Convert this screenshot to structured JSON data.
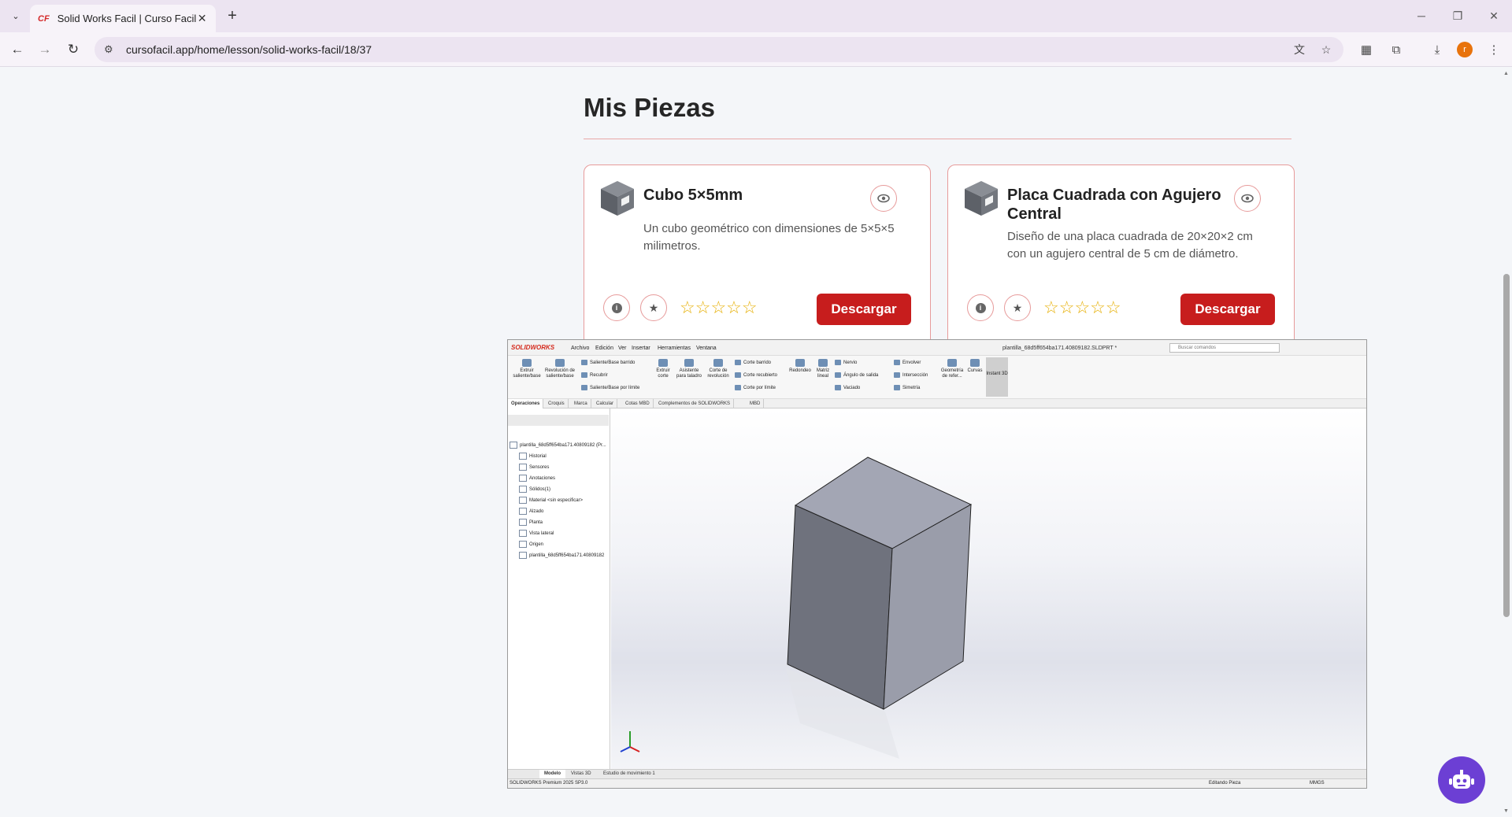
{
  "browser": {
    "tab_title": "Solid Works Facil | Curso Facil",
    "favicon_text": "CF",
    "url": "cursofacil.app/home/lesson/solid-works-facil/18/37",
    "profile_initial": "r"
  },
  "section": {
    "title": "Mis Piezas"
  },
  "cards": [
    {
      "title": "Cubo 5×5mm",
      "description": "Un cubo geométrico con dimensiones de 5×5×5 milimetros.",
      "download_label": "Descargar",
      "stars": "☆☆☆☆☆",
      "rating": 0
    },
    {
      "title": "Placa Cuadrada con Agujero Central",
      "description": "Diseño de una placa cuadrada de 20×20×2 cm con un agujero central de 5 cm de diámetro.",
      "download_label": "Descargar",
      "stars": "☆☆☆☆☆",
      "rating": 0
    }
  ],
  "solidworks": {
    "logo": "SOLIDWORKS",
    "menu": [
      "Archivo",
      "Edición",
      "Ver",
      "Insertar",
      "Herramientas",
      "Ventana"
    ],
    "document": "plantilla_68d5ff654ba171.40809182.SLDPRT *",
    "search_placeholder": "Buscar comandos",
    "ribbon": {
      "extrude": "Extruir saliente/base",
      "revolve": "Revolución de saliente/base",
      "sweep": "Saliente/Base barrido",
      "loft": "Recubrir",
      "boundary": "Saliente/Base por límite",
      "extrude_cut": "Extruir corte",
      "hole_wizard": "Asistente para taladro",
      "revolve_cut": "Corte de revolución",
      "swept_cut": "Corte barrido",
      "lofted_cut": "Corte recubierto",
      "boundary_cut": "Corte por límite",
      "fillet": "Redondeo",
      "pattern": "Matriz lineal",
      "rib": "Nervio",
      "draft": "Ángulo de salida",
      "shell": "Vaciado",
      "wrap": "Envolver",
      "intersect": "Intersección",
      "mirror": "Simetría",
      "ref_geometry": "Geometría de refer...",
      "curves": "Curvas",
      "instant3d": "Instant 3D"
    },
    "tabs": [
      "Operaciones",
      "Croquis",
      "Marca",
      "Calcular",
      "Cotas MBD",
      "Complementos de SOLIDWORKS",
      "MBD"
    ],
    "tree": {
      "root": "plantilla_68d5ff654ba171.40809182 (Pr...",
      "items": [
        "Historial",
        "Sensores",
        "Anotaciones",
        "Sólidos(1)",
        "Material <sin especificar>",
        "Alzado",
        "Planta",
        "Vista lateral",
        "Origen",
        "plantilla_68d5ff654ba171.40809182"
      ]
    },
    "bottom_tabs": [
      "Modelo",
      "Vistas 3D",
      "Estudio de movimiento 1"
    ],
    "status_left": "SOLIDWORKS Premium 2025 SP3.0",
    "status_mode": "Editando Pieza",
    "status_units": "MMGS"
  },
  "colors": {
    "accent": "#c71d1d",
    "card_border": "#e79b9b",
    "star": "#e7b10a",
    "chat": "#6c3fd4"
  }
}
